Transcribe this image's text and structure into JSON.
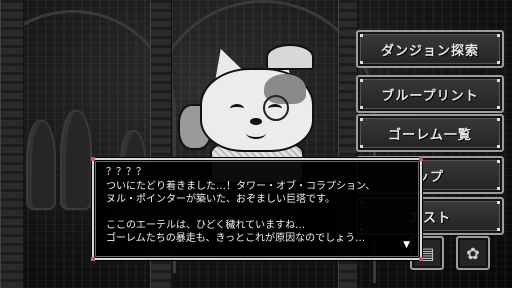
{
  "menu": {
    "items": [
      {
        "label": "ダンジョン探索"
      },
      {
        "label": "ブループリント"
      },
      {
        "label": "ゴーレム一覧"
      },
      {
        "label": "ップ"
      },
      {
        "label": "エスト"
      }
    ],
    "icon_buttons": [
      {
        "icon": "book-icon",
        "glyph": "▤"
      },
      {
        "icon": "settings-emblem-icon",
        "glyph": "✿"
      }
    ]
  },
  "dialog": {
    "speaker": "？？？？",
    "lines": [
      "ついにたどり着きました…！タワー・オブ・コラプション、",
      "ヌル・ポインターが築いた、おぞましい巨塔です。",
      "",
      "ここのエーテルは、ひどく穢れていますね…",
      "ゴーレムたちの暴走も、きっとこれが原因なのでしょう…"
    ],
    "advance_glyph": "▼"
  },
  "colors": {
    "frame": "#d9d9d9",
    "accent_corner": "#c45a6a",
    "menu_border": "#9c9c9c"
  }
}
